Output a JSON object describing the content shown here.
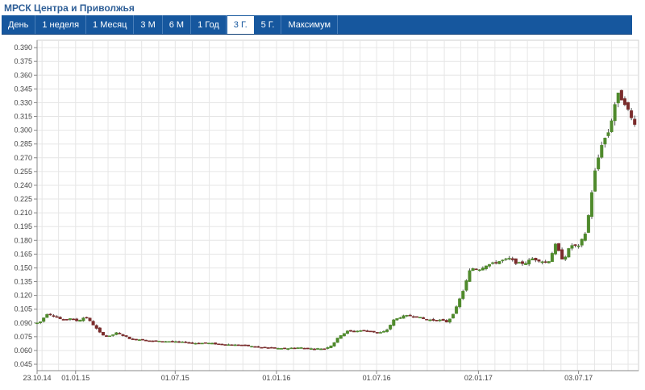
{
  "header": {
    "title": "МРСК Центра и Приволжья"
  },
  "tabs": [
    {
      "label": "День",
      "active": false
    },
    {
      "label": "1 неделя",
      "active": false
    },
    {
      "label": "1 Месяц",
      "active": false
    },
    {
      "label": "3 М",
      "active": false
    },
    {
      "label": "6 М",
      "active": false
    },
    {
      "label": "1 Год",
      "active": false
    },
    {
      "label": "3 Г.",
      "active": true
    },
    {
      "label": "5 Г.",
      "active": false
    },
    {
      "label": "Максимум",
      "active": false
    }
  ],
  "chart_data": {
    "type": "candlestick",
    "title": "",
    "xlabel": "",
    "ylabel": "",
    "ylim": [
      0.038,
      0.398
    ],
    "y_ticks": [
      0.045,
      0.06,
      0.075,
      0.09,
      0.105,
      0.12,
      0.135,
      0.15,
      0.165,
      0.18,
      0.195,
      0.21,
      0.225,
      0.24,
      0.255,
      0.27,
      0.285,
      0.3,
      0.315,
      0.33,
      0.345,
      0.36,
      0.375,
      0.39
    ],
    "x_ticks": [
      "23.10.14",
      "01.01.15",
      "01.07.15",
      "01.01.16",
      "01.07.16",
      "02.01.17",
      "03.07.17"
    ],
    "x_start": "2014-10-23",
    "x_end": "2017-10-20",
    "grid": true,
    "colors": {
      "up": "#4f8a2c",
      "down": "#7a2b2b",
      "wick": "#555555",
      "grid": "#e6e6e6",
      "axis": "#888888",
      "tabbar": "#16579e"
    },
    "close_series": [
      [
        "2014-10-27",
        0.09
      ],
      [
        "2014-11-10",
        0.1
      ],
      [
        "2014-11-24",
        0.098
      ],
      [
        "2014-12-08",
        0.093
      ],
      [
        "2014-12-22",
        0.095
      ],
      [
        "2015-01-05",
        0.092
      ],
      [
        "2015-01-19",
        0.097
      ],
      [
        "2015-02-02",
        0.088
      ],
      [
        "2015-02-16",
        0.078
      ],
      [
        "2015-03-02",
        0.075
      ],
      [
        "2015-03-16",
        0.079
      ],
      [
        "2015-03-30",
        0.076
      ],
      [
        "2015-04-13",
        0.072
      ],
      [
        "2015-04-27",
        0.072
      ],
      [
        "2015-05-11",
        0.071
      ],
      [
        "2015-05-25",
        0.07
      ],
      [
        "2015-06-08",
        0.07
      ],
      [
        "2015-06-22",
        0.07
      ],
      [
        "2015-07-06",
        0.069
      ],
      [
        "2015-07-20",
        0.069
      ],
      [
        "2015-08-03",
        0.068
      ],
      [
        "2015-08-17",
        0.068
      ],
      [
        "2015-08-31",
        0.068
      ],
      [
        "2015-09-14",
        0.067
      ],
      [
        "2015-09-28",
        0.067
      ],
      [
        "2015-10-12",
        0.066
      ],
      [
        "2015-10-26",
        0.066
      ],
      [
        "2015-11-09",
        0.065
      ],
      [
        "2015-11-23",
        0.064
      ],
      [
        "2015-12-07",
        0.063
      ],
      [
        "2015-12-21",
        0.063
      ],
      [
        "2016-01-04",
        0.062
      ],
      [
        "2016-01-18",
        0.062
      ],
      [
        "2016-02-01",
        0.063
      ],
      [
        "2016-02-15",
        0.063
      ],
      [
        "2016-02-29",
        0.062
      ],
      [
        "2016-03-14",
        0.062
      ],
      [
        "2016-03-28",
        0.062
      ],
      [
        "2016-04-11",
        0.066
      ],
      [
        "2016-04-25",
        0.076
      ],
      [
        "2016-05-09",
        0.081
      ],
      [
        "2016-05-23",
        0.081
      ],
      [
        "2016-06-06",
        0.082
      ],
      [
        "2016-06-20",
        0.081
      ],
      [
        "2016-07-04",
        0.079
      ],
      [
        "2016-07-18",
        0.081
      ],
      [
        "2016-08-01",
        0.093
      ],
      [
        "2016-08-15",
        0.097
      ],
      [
        "2016-08-29",
        0.098
      ],
      [
        "2016-09-12",
        0.097
      ],
      [
        "2016-09-26",
        0.094
      ],
      [
        "2016-10-10",
        0.093
      ],
      [
        "2016-10-24",
        0.093
      ],
      [
        "2016-11-07",
        0.091
      ],
      [
        "2016-11-21",
        0.104
      ],
      [
        "2016-12-05",
        0.125
      ],
      [
        "2016-12-19",
        0.15
      ],
      [
        "2017-01-02",
        0.148
      ],
      [
        "2017-01-16",
        0.153
      ],
      [
        "2017-01-30",
        0.155
      ],
      [
        "2017-02-13",
        0.158
      ],
      [
        "2017-02-27",
        0.16
      ],
      [
        "2017-03-13",
        0.155
      ],
      [
        "2017-03-27",
        0.155
      ],
      [
        "2017-04-10",
        0.16
      ],
      [
        "2017-04-24",
        0.158
      ],
      [
        "2017-05-08",
        0.155
      ],
      [
        "2017-05-22",
        0.175
      ],
      [
        "2017-06-05",
        0.158
      ],
      [
        "2017-06-19",
        0.175
      ],
      [
        "2017-07-03",
        0.173
      ],
      [
        "2017-07-17",
        0.19
      ],
      [
        "2017-07-31",
        0.25
      ],
      [
        "2017-08-14",
        0.285
      ],
      [
        "2017-08-28",
        0.3
      ],
      [
        "2017-09-11",
        0.34
      ],
      [
        "2017-09-25",
        0.33
      ],
      [
        "2017-10-09",
        0.31
      ],
      [
        "2017-10-20",
        0.305
      ]
    ]
  }
}
